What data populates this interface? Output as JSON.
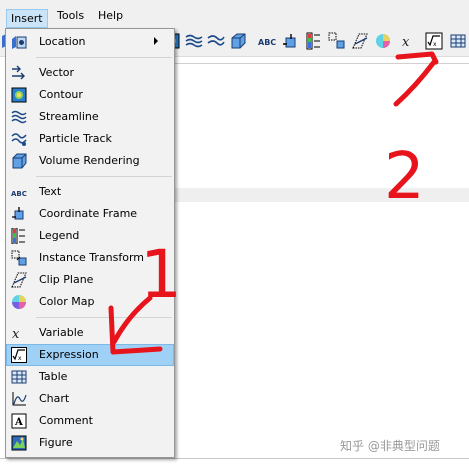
{
  "menubar": {
    "items": [
      {
        "label": "Insert",
        "active": true
      },
      {
        "label": "Tools",
        "active": false
      },
      {
        "label": "Help",
        "active": false
      }
    ]
  },
  "toolbar": {
    "icons": [
      "contour-icon",
      "streamline-icon",
      "particle-track-icon",
      "volume-rendering-icon",
      "text-icon",
      "coordinate-frame-icon",
      "legend-icon",
      "instance-transform-icon",
      "clip-plane-icon",
      "color-map-icon",
      "variable-icon",
      "expression-icon",
      "table-icon"
    ]
  },
  "insert_menu": {
    "items": [
      {
        "label": "Location",
        "icon": "location-icon",
        "submenu": true
      },
      {
        "label": "Vector",
        "icon": "vector-icon"
      },
      {
        "label": "Contour",
        "icon": "contour-icon"
      },
      {
        "label": "Streamline",
        "icon": "streamline-icon"
      },
      {
        "label": "Particle Track",
        "icon": "particle-track-icon"
      },
      {
        "label": "Volume Rendering",
        "icon": "volume-rendering-icon"
      },
      {
        "label": "Text",
        "icon": "text-icon"
      },
      {
        "label": "Coordinate Frame",
        "icon": "coordinate-frame-icon"
      },
      {
        "label": "Legend",
        "icon": "legend-icon"
      },
      {
        "label": "Instance Transform",
        "icon": "instance-transform-icon"
      },
      {
        "label": "Clip Plane",
        "icon": "clip-plane-icon"
      },
      {
        "label": "Color Map",
        "icon": "color-map-icon"
      },
      {
        "label": "Variable",
        "icon": "variable-icon"
      },
      {
        "label": "Expression",
        "icon": "expression-icon",
        "highlighted": true
      },
      {
        "label": "Table",
        "icon": "table-icon"
      },
      {
        "label": "Chart",
        "icon": "chart-icon"
      },
      {
        "label": "Comment",
        "icon": "comment-icon"
      },
      {
        "label": "Figure",
        "icon": "figure-icon"
      }
    ]
  },
  "annotations": {
    "label_1": "1",
    "label_2": "2",
    "color": "#e8141c"
  },
  "watermark": "知乎 @非典型问题",
  "colors": {
    "menu_bg": "#f2f2f2",
    "highlight": "#9fd0f5",
    "annotation_red": "#e8141c"
  }
}
